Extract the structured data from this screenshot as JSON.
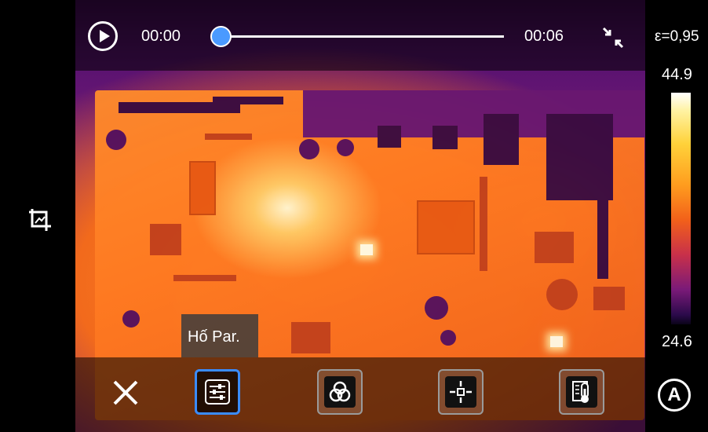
{
  "player": {
    "current_time": "00:00",
    "end_time": "00:06",
    "progress": 0
  },
  "scale": {
    "emissivity": "ε=0,95",
    "max_temp": "44.9",
    "min_temp": "24.6",
    "palette": "iron"
  },
  "toolbar": {
    "tooltip": "Hố Par.",
    "tools": [
      {
        "name": "parameters-button",
        "icon": "sliders-icon",
        "active": true
      },
      {
        "name": "palette-button",
        "icon": "color-circles-icon",
        "active": false
      },
      {
        "name": "center-spot-button",
        "icon": "crosshair-icon",
        "active": false
      },
      {
        "name": "temperature-button",
        "icon": "thermometer-icon",
        "active": false
      }
    ]
  },
  "icons": {
    "crop": "crop-icon",
    "play": "play-icon",
    "shrink": "shrink-icon",
    "close": "close-icon",
    "auto": "auto-icon"
  },
  "colors": {
    "accent": "#3a8cff",
    "slider_thumb": "#4a9aff"
  }
}
